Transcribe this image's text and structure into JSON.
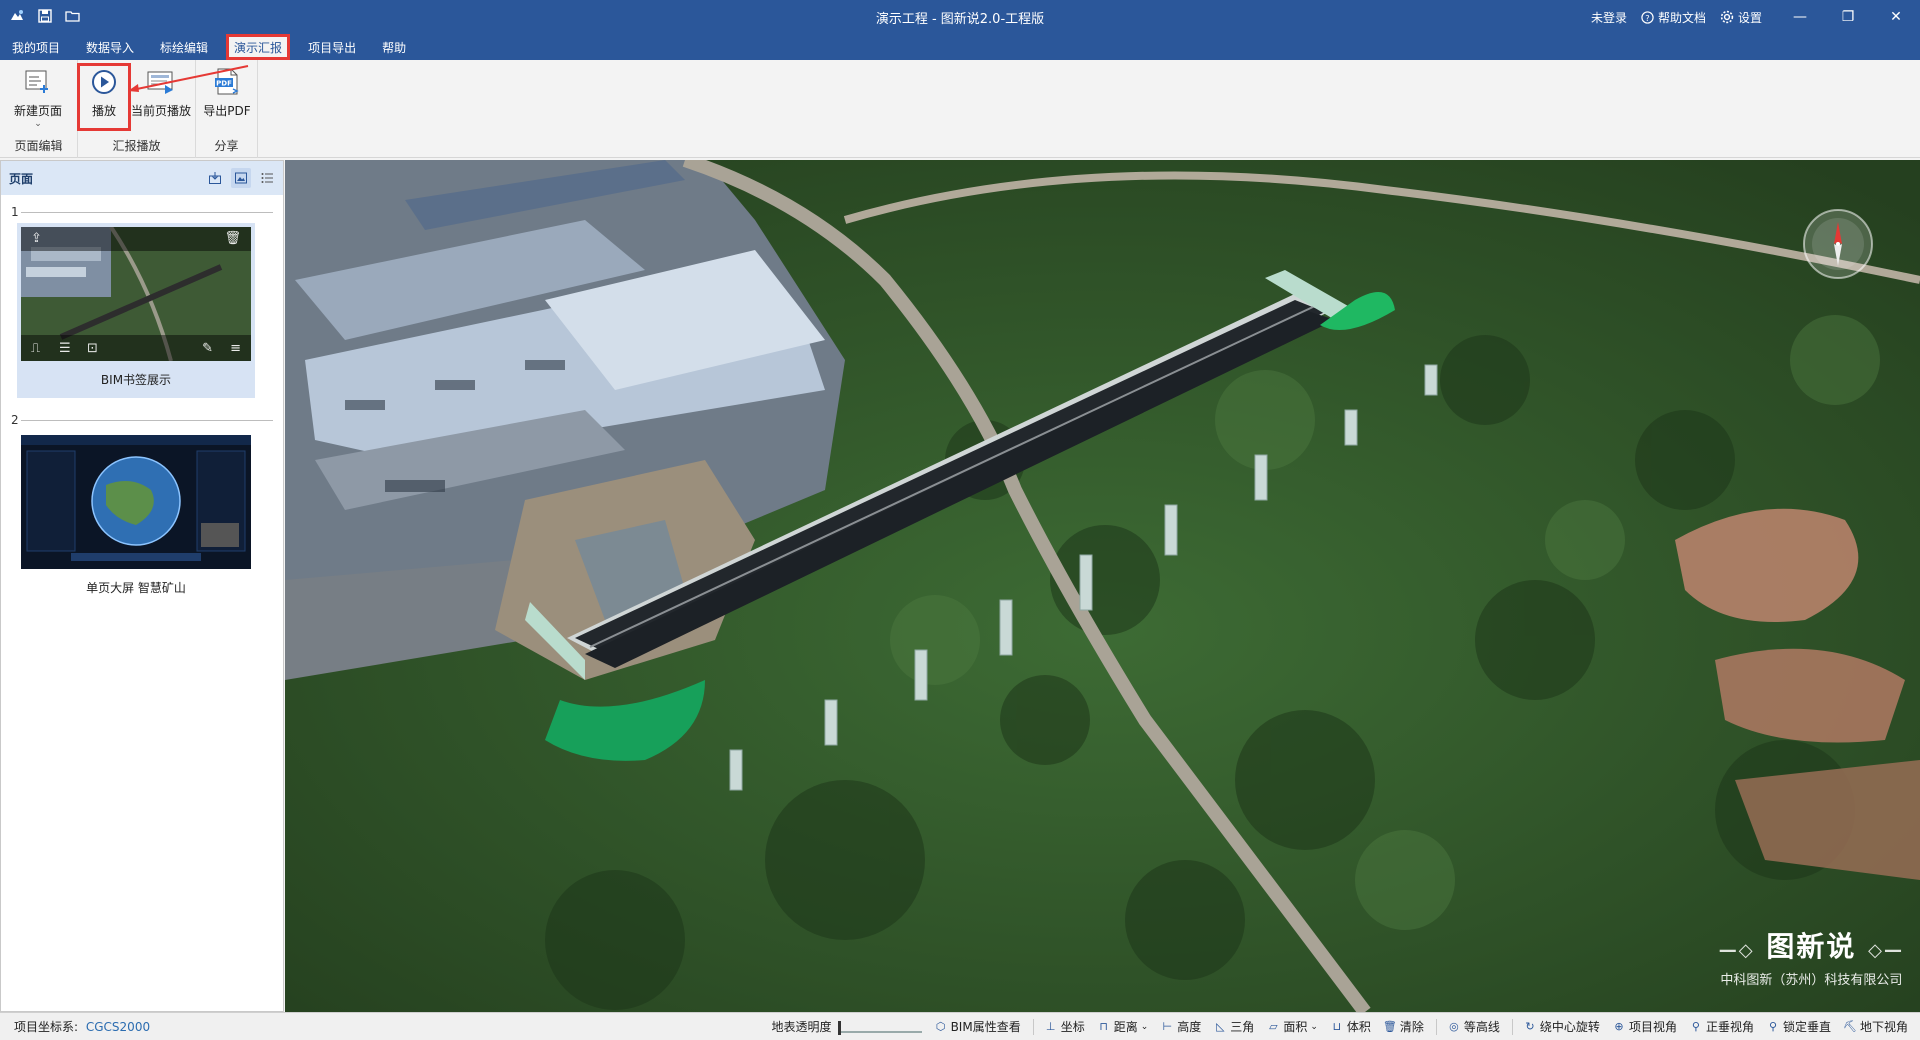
{
  "window": {
    "title": "演示工程 - 图新说2.0-工程版",
    "login": "未登录",
    "help_doc": "帮助文档",
    "settings": "设置"
  },
  "menu": {
    "items": [
      "我的项目",
      "数据导入",
      "标绘编辑",
      "演示汇报",
      "项目导出",
      "帮助"
    ],
    "active_index": 3
  },
  "ribbon": {
    "groups": [
      {
        "label": "页面编辑",
        "buttons": [
          {
            "label": "新建页面"
          }
        ]
      },
      {
        "label": "汇报播放",
        "buttons": [
          {
            "label": "播放"
          },
          {
            "label": "当前页播放"
          }
        ]
      },
      {
        "label": "分享",
        "buttons": [
          {
            "label": "导出PDF"
          }
        ]
      }
    ]
  },
  "panel": {
    "title": "页面",
    "pages": [
      {
        "number": "1",
        "name": "BIM书签展示",
        "selected": true
      },
      {
        "number": "2",
        "name": "单页大屏 智慧矿山",
        "selected": false
      }
    ]
  },
  "viewport": {
    "watermark_title": "图新说",
    "watermark_company": "中科图新（苏州）科技有限公司"
  },
  "status": {
    "crs_label": "项目坐标系:",
    "crs_value": "CGCS2000",
    "opacity_label": "地表透明度",
    "opacity_value": 0,
    "tools": [
      "BIM属性查看",
      "坐标",
      "距离",
      "高度",
      "三角",
      "面积",
      "体积",
      "清除",
      "等高线",
      "绕中心旋转",
      "项目视角",
      "正垂视角",
      "锁定垂直",
      "地下视角"
    ]
  },
  "colors": {
    "titlebar": "#2b579a",
    "highlight": "#e53935",
    "accent_link": "#2b6cb0"
  }
}
